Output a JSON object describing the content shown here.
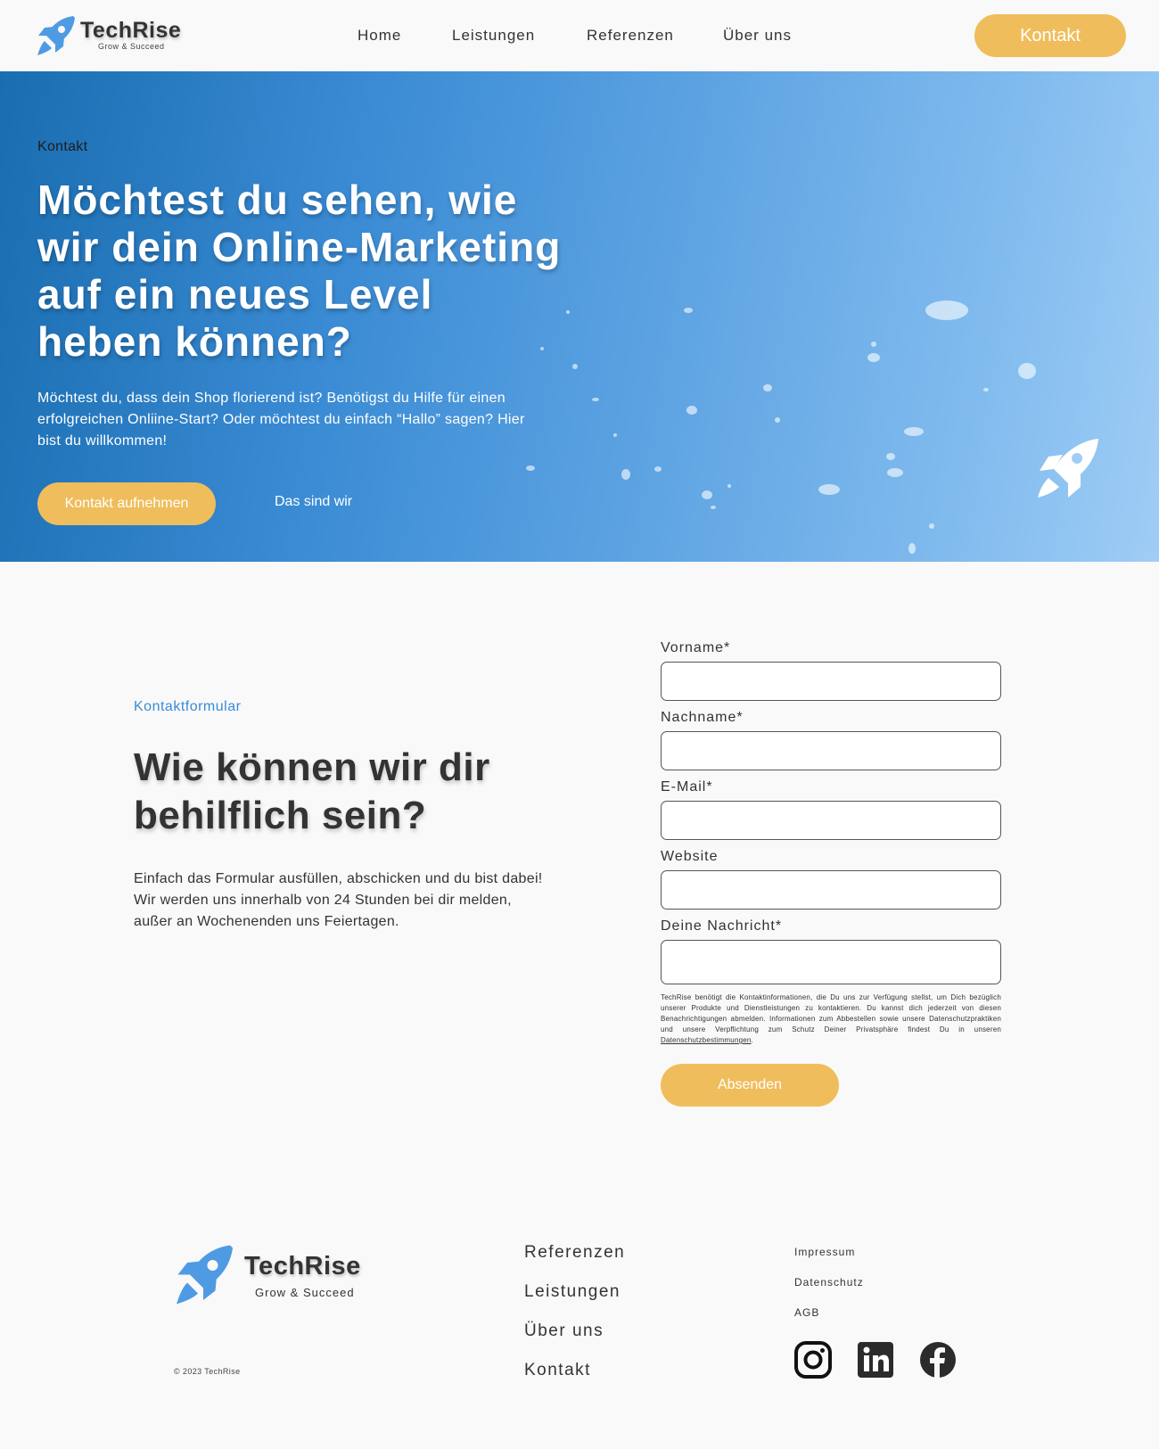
{
  "header": {
    "brand": "TechRise",
    "tagline": "Grow & Succeed",
    "nav": [
      "Home",
      "Leistungen",
      "Referenzen",
      "Über uns"
    ],
    "cta": "Kontakt"
  },
  "hero": {
    "eyebrow": "Kontakt",
    "title": "Möchtest du sehen, wie wir dein Online-Marketing auf ein neues Level heben können?",
    "text": "Möchtest du, dass dein Shop florierend ist? Benötigst du Hilfe für einen erfolgreichen Onliine-Start? Oder möchtest du einfach “Hallo” sagen? Hier bist du willkommen!",
    "primary_button": "Kontakt aufnehmen",
    "secondary_link": "Das sind wir"
  },
  "contact": {
    "eyebrow": "Kontaktformular",
    "title": "Wie können wir dir behilflich sein?",
    "text": "Einfach das Formular ausfüllen, abschicken und du bist dabei! Wir werden uns innerhalb von 24 Stunden bei dir melden, außer an Wochenenden uns Feiertagen."
  },
  "form": {
    "fields": [
      {
        "label": "Vorname*",
        "value": ""
      },
      {
        "label": "Nachname*",
        "value": ""
      },
      {
        "label": "E-Mail*",
        "value": ""
      },
      {
        "label": "Website",
        "value": ""
      },
      {
        "label": "Deine Nachricht*",
        "value": ""
      }
    ],
    "disclaimer": "TechRise benötigt die Kontaktinformationen, die Du uns zur Verfügung stellst, um Dich bezüglich unserer Produkte und Dienstleistungen zu kontaktieren. Du kannst dich jederzeit von diesen Benachrichtigungen abmelden. Informationen zum Abbestellen sowie unsere Datenschutzpraktiken und unsere Verpflichtung zum Schutz Deiner Privatsphäre findest Du in unseren ",
    "disclaimer_link": "Datenschutzbestimmungen",
    "disclaimer_end": ".",
    "submit": "Absenden"
  },
  "footer": {
    "brand": "TechRise",
    "tagline": "Grow & Succeed",
    "copyright": "© 2023 TechRise",
    "links": [
      "Referenzen",
      "Leistungen",
      "Über uns",
      "Kontakt"
    ],
    "legal": [
      "Impressum",
      "Datenschutz",
      "AGB"
    ],
    "social": [
      "instagram-icon",
      "linkedin-icon",
      "facebook-icon"
    ]
  },
  "colors": {
    "accent": "#f0bd5c",
    "brand_blue": "#3b8bd6",
    "text": "#333333",
    "background": "#f9f9f9"
  }
}
